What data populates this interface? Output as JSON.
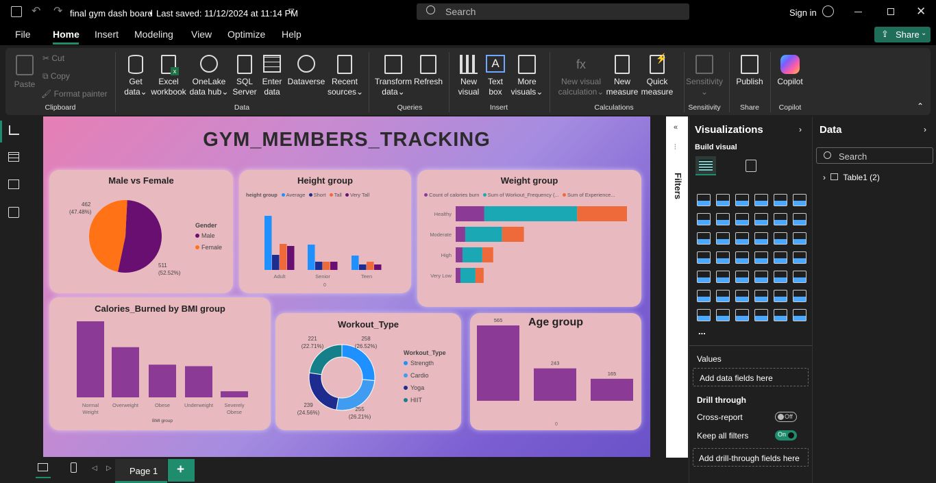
{
  "titlebar": {
    "file_title": "final gym dash board",
    "saved_text": "Last saved: 11/12/2024 at 11:14 PM",
    "search_placeholder": "Search",
    "sign_in": "Sign in"
  },
  "menu": {
    "items": [
      "File",
      "Home",
      "Insert",
      "Modeling",
      "View",
      "Optimize",
      "Help"
    ],
    "active": "Home",
    "share_label": "Share"
  },
  "ribbon": {
    "clipboard": {
      "paste": "Paste",
      "cut": "Cut",
      "copy": "Copy",
      "format_painter": "Format painter",
      "group": "Clipboard"
    },
    "data": {
      "get_data": [
        "Get",
        "data"
      ],
      "excel": [
        "Excel",
        "workbook"
      ],
      "onelake": [
        "OneLake",
        "data hub"
      ],
      "sql": [
        "SQL",
        "Server"
      ],
      "enter": [
        "Enter",
        "data"
      ],
      "dataverse": "Dataverse",
      "recent": [
        "Recent",
        "sources"
      ],
      "group": "Data"
    },
    "queries": {
      "transform": [
        "Transform",
        "data"
      ],
      "refresh": "Refresh",
      "group": "Queries"
    },
    "insert": {
      "new_visual": [
        "New",
        "visual"
      ],
      "text_box": [
        "Text",
        "box"
      ],
      "more_visuals": [
        "More",
        "visuals"
      ],
      "group": "Insert"
    },
    "calculations": {
      "new_visual_calc": [
        "New visual",
        "calculation"
      ],
      "new_measure": [
        "New",
        "measure"
      ],
      "quick_measure": [
        "Quick",
        "measure"
      ],
      "group": "Calculations"
    },
    "sensitivity": {
      "label": "Sensitivity",
      "group": "Sensitivity"
    },
    "share": {
      "publish": "Publish",
      "group": "Share"
    },
    "copilot": {
      "label": "Copilot",
      "group": "Copilot"
    }
  },
  "report": {
    "title": "GYM_MEMBERS_TRACKING"
  },
  "colors": {
    "purple": "#6a0f72",
    "orange": "#ff7316",
    "blue": "#1e90ff",
    "navy": "#1f2c8f",
    "coral": "#ee6a3a",
    "teal": "#1aa8b5",
    "violet": "#8b3a96",
    "accent_green": "#1f8c6e"
  },
  "chart_data": [
    {
      "type": "pie",
      "title": "Male vs Female",
      "legend_title": "Gender",
      "categories": [
        "Male",
        "Female"
      ],
      "values": [
        511,
        462
      ],
      "labels": [
        "511",
        "462"
      ],
      "percent_labels": [
        "(52.52%)",
        "(47.48%)"
      ]
    },
    {
      "type": "bar",
      "title": "Height group",
      "legend_title": "height group",
      "categories": [
        "Adult",
        "Senior",
        "Teen"
      ],
      "series": [
        {
          "name": "Average",
          "values": [
            79,
            37,
            21
          ]
        },
        {
          "name": "Short",
          "values": [
            22,
            12,
            8
          ]
        },
        {
          "name": "Tall",
          "values": [
            38,
            12,
            12
          ]
        },
        {
          "name": "Very Tall",
          "values": [
            35,
            12,
            8
          ]
        }
      ],
      "zero_label": "0"
    },
    {
      "type": "bar",
      "orientation": "horizontal",
      "stacked": true,
      "title": "Weight group",
      "categories": [
        "Healthy",
        "Moderate",
        "High",
        "Very Low"
      ],
      "series": [
        {
          "name": "Count of calories burn",
          "values": [
            42,
            14,
            10,
            7
          ]
        },
        {
          "name": "Sum of Workout_Frequency (...",
          "values": [
            136,
            54,
            29,
            22
          ]
        },
        {
          "name": "Sum of Experience...",
          "values": [
            73,
            32,
            16,
            12
          ]
        }
      ]
    },
    {
      "type": "bar",
      "title": "Calories_Burned by BMI group",
      "xlabel": "BMI group",
      "categories": [
        [
          "Normal",
          "Weight"
        ],
        [
          "Overweight"
        ],
        [
          "Obese"
        ],
        [
          "Underweight"
        ],
        [
          "Severely",
          "Obese"
        ]
      ],
      "values": [
        100,
        66,
        43,
        41,
        8
      ]
    },
    {
      "type": "pie",
      "donut": true,
      "title": "Workout_Type",
      "legend_title": "Workout_Type",
      "categories": [
        "Strength",
        "Cardio",
        "Yoga",
        "HIIT"
      ],
      "values": [
        258,
        255,
        239,
        221
      ],
      "labels": [
        "258",
        "255",
        "239",
        "221"
      ],
      "percent_labels": [
        "(26.52%)",
        "(26.21%)",
        "(24.56%)",
        "(22.71%)"
      ]
    },
    {
      "type": "bar",
      "title": "Age group",
      "values": [
        565,
        243,
        165
      ],
      "labels": [
        "565",
        "243",
        "165"
      ],
      "zero_label": "0"
    }
  ],
  "filters": {
    "label": "Filters"
  },
  "viz": {
    "title": "Visualizations",
    "build": "Build visual",
    "values_label": "Values",
    "add_data": "Add data fields here",
    "drill": "Drill through",
    "cross_report": "Cross-report",
    "cross_state": "Off",
    "keep_filters": "Keep all filters",
    "keep_state": "On",
    "add_drill": "Add drill-through fields here",
    "more": "..."
  },
  "data_pane": {
    "title": "Data",
    "search_placeholder": "Search",
    "table": "Table1 (2)"
  },
  "pages": {
    "tab": "Page 1",
    "add": "+"
  }
}
